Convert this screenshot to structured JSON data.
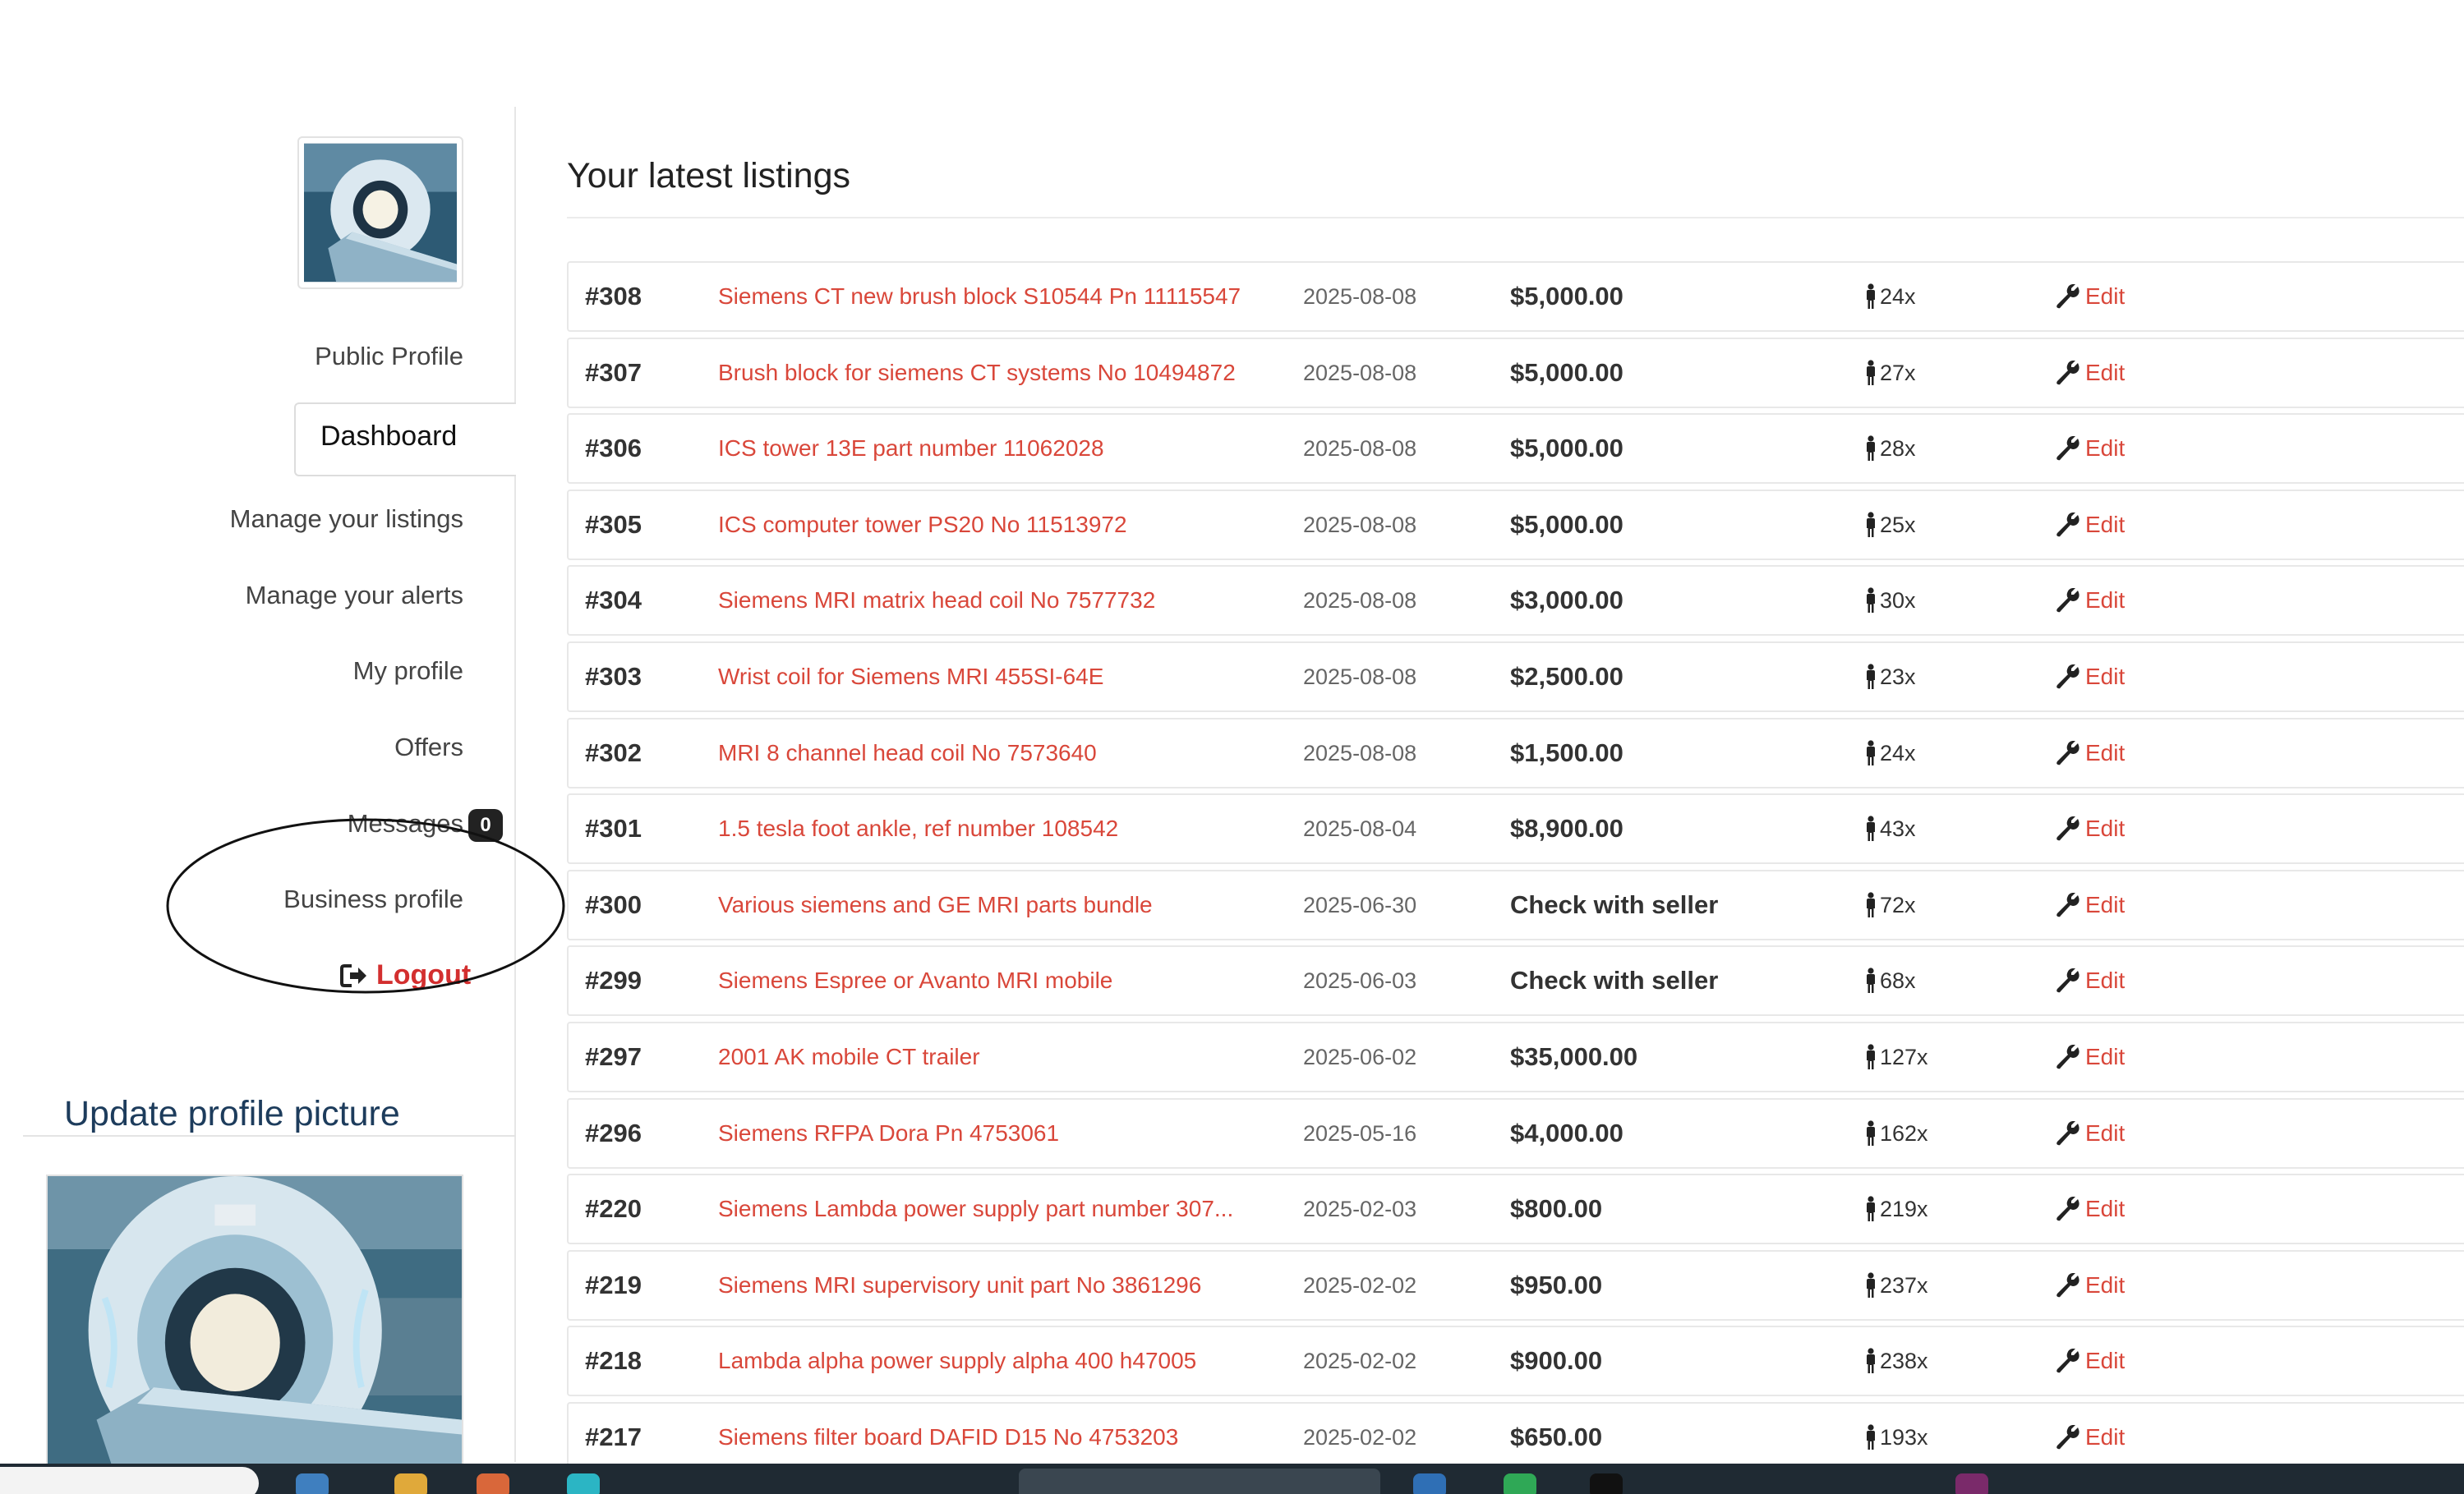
{
  "sidebar": {
    "items": [
      {
        "label": "Public Profile"
      },
      {
        "label": "Dashboard"
      },
      {
        "label": "Manage your listings"
      },
      {
        "label": "Manage your alerts"
      },
      {
        "label": "My profile"
      },
      {
        "label": "Offers"
      },
      {
        "label": "Messages"
      },
      {
        "label": "Business profile"
      },
      {
        "label": "Logout"
      }
    ],
    "messages_badge": "0",
    "update_picture_title": "Update profile picture"
  },
  "main": {
    "title": "Your latest listings",
    "edit_label": "Edit",
    "listings": [
      {
        "id": "#308",
        "title": "Siemens CT new brush block S10544 Pn 11115547",
        "date": "2025-08-08",
        "price": "$5,000.00",
        "views": "24x"
      },
      {
        "id": "#307",
        "title": "Brush block for siemens CT systems No 10494872",
        "date": "2025-08-08",
        "price": "$5,000.00",
        "views": "27x"
      },
      {
        "id": "#306",
        "title": "ICS tower 13E part number 11062028",
        "date": "2025-08-08",
        "price": "$5,000.00",
        "views": "28x"
      },
      {
        "id": "#305",
        "title": "ICS computer tower PS20 No 11513972",
        "date": "2025-08-08",
        "price": "$5,000.00",
        "views": "25x"
      },
      {
        "id": "#304",
        "title": "Siemens MRI matrix head coil No 7577732",
        "date": "2025-08-08",
        "price": "$3,000.00",
        "views": "30x"
      },
      {
        "id": "#303",
        "title": "Wrist coil for Siemens MRI 455SI-64E",
        "date": "2025-08-08",
        "price": "$2,500.00",
        "views": "23x"
      },
      {
        "id": "#302",
        "title": "MRI 8 channel head coil No 7573640",
        "date": "2025-08-08",
        "price": "$1,500.00",
        "views": "24x"
      },
      {
        "id": "#301",
        "title": "1.5 tesla foot ankle, ref number 108542",
        "date": "2025-08-04",
        "price": "$8,900.00",
        "views": "43x"
      },
      {
        "id": "#300",
        "title": "Various siemens and GE MRI parts bundle",
        "date": "2025-06-30",
        "price": "Check with seller",
        "views": "72x"
      },
      {
        "id": "#299",
        "title": "Siemens Espree or Avanto MRI mobile",
        "date": "2025-06-03",
        "price": "Check with seller",
        "views": "68x"
      },
      {
        "id": "#297",
        "title": "2001 AK mobile CT trailer",
        "date": "2025-06-02",
        "price": "$35,000.00",
        "views": "127x"
      },
      {
        "id": "#296",
        "title": "Siemens RFPA Dora Pn 4753061",
        "date": "2025-05-16",
        "price": "$4,000.00",
        "views": "162x"
      },
      {
        "id": "#220",
        "title": "Siemens Lambda power supply part number 307...",
        "date": "2025-02-03",
        "price": "$800.00",
        "views": "219x"
      },
      {
        "id": "#219",
        "title": "Siemens MRI supervisory unit part No 3861296",
        "date": "2025-02-02",
        "price": "$950.00",
        "views": "237x"
      },
      {
        "id": "#218",
        "title": "Lambda alpha power supply alpha 400 h47005",
        "date": "2025-02-02",
        "price": "$900.00",
        "views": "238x"
      },
      {
        "id": "#217",
        "title": "Siemens filter board DAFID D15 No 4753203",
        "date": "2025-02-02",
        "price": "$650.00",
        "views": "193x"
      }
    ]
  },
  "colors": {
    "link": "#d9473a",
    "logout": "#d32f2f",
    "heading_blue": "#1d3c5c",
    "taskbar": "#1f2a33"
  }
}
